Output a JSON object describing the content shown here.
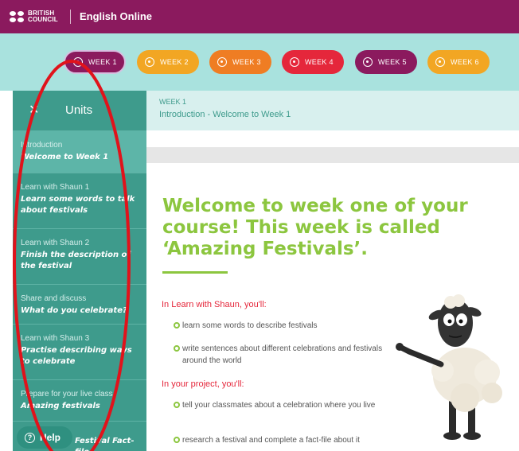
{
  "header": {
    "logo_text_line1": "BRITISH",
    "logo_text_line2": "COUNCIL",
    "app_title": "English Online"
  },
  "weeks": [
    {
      "label": "WEEK 1",
      "color": "#8b1a5e"
    },
    {
      "label": "WEEK 2",
      "color": "#f2a623"
    },
    {
      "label": "WEEK 3",
      "color": "#ef7d23"
    },
    {
      "label": "WEEK 4",
      "color": "#e5273b"
    },
    {
      "label": "WEEK 5",
      "color": "#8b1a5e"
    },
    {
      "label": "WEEK 6",
      "color": "#f2a623"
    }
  ],
  "sidebar": {
    "title": "Units",
    "collapse_icon": "close-icon",
    "items": [
      {
        "category": "Introduction",
        "title": "Welcome to Week 1"
      },
      {
        "category": "Learn with Shaun 1",
        "title": "Learn some words to talk about festivals"
      },
      {
        "category": "Learn with Shaun 2",
        "title": "Finish the description of the festival"
      },
      {
        "category": "Share and discuss",
        "title": "What do you celebrate?"
      },
      {
        "category": "Learn with Shaun 3",
        "title": "Practise describing ways to celebrate"
      },
      {
        "category": "Prepare for your live class",
        "title": "Amazing festivals"
      },
      {
        "category": "",
        "title": "Festival Fact-file"
      }
    ],
    "help_label": "Help"
  },
  "content_header": {
    "week": "WEEK 1",
    "breadcrumb": "Introduction - Welcome to Week 1"
  },
  "main": {
    "welcome_heading": "Welcome to week one of your course! This week is called ‘Amazing Festivals’.",
    "section1_heading": "In Learn with Shaun, you'll:",
    "section1_bullets": [
      "learn some words to describe festivals",
      "write sentences about different celebrations and festivals around the world"
    ],
    "section2_heading": "In your project, you'll:",
    "section2_bullets": [
      "tell your classmates about a celebration where you live",
      "research a festival and complete a fact-file about it"
    ]
  },
  "colors": {
    "topbar": "#8b1a5e",
    "weekstrip": "#a9e2de",
    "sidebar": "#3e9b8c",
    "heading_green": "#8cc63f",
    "section_red": "#e5273b",
    "annotation_red": "#e0131b"
  }
}
